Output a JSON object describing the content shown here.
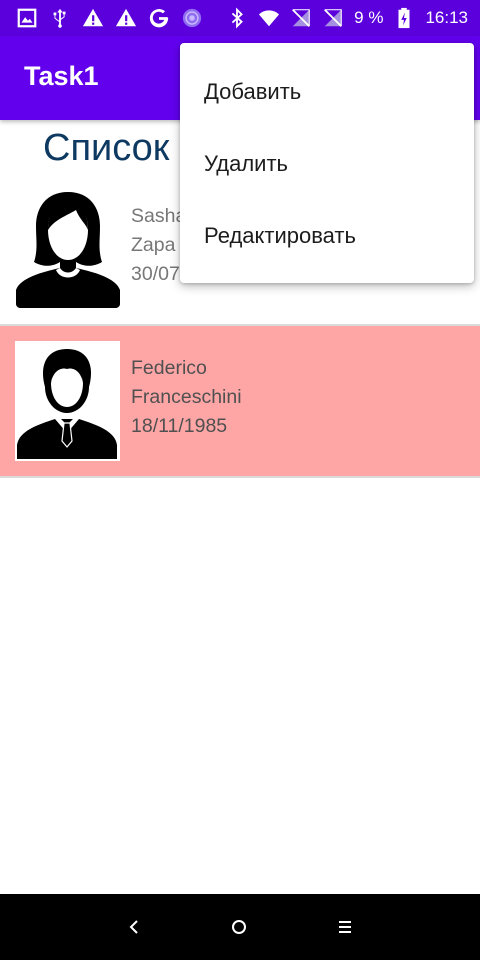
{
  "status_bar": {
    "icons": [
      "gallery-icon",
      "usb-icon",
      "warning-icon",
      "warning-icon",
      "google-icon",
      "sync-icon",
      "bluetooth-icon",
      "wifi-icon",
      "no-signal-icon",
      "no-signal-icon",
      "battery-charging-icon"
    ],
    "battery_percent": "9 %",
    "time": "16:13"
  },
  "app_bar": {
    "title": "Task1",
    "color": "#6200ee"
  },
  "main": {
    "heading": "Список"
  },
  "list_items": [
    {
      "first_name": "Sasha",
      "last_name": "Zapa",
      "date": "30/07",
      "avatar": "female-avatar-icon",
      "background": "#ffffff"
    },
    {
      "first_name": "Federico",
      "last_name": "Franceschini",
      "date": "18/11/1985",
      "avatar": "male-avatar-icon",
      "background": "#fea6a6"
    }
  ],
  "popup_menu": {
    "items": [
      "Добавить",
      "Удалить",
      "Редактировать"
    ]
  },
  "nav_bar": {
    "icons": [
      "back-icon",
      "home-icon",
      "recents-icon"
    ]
  }
}
